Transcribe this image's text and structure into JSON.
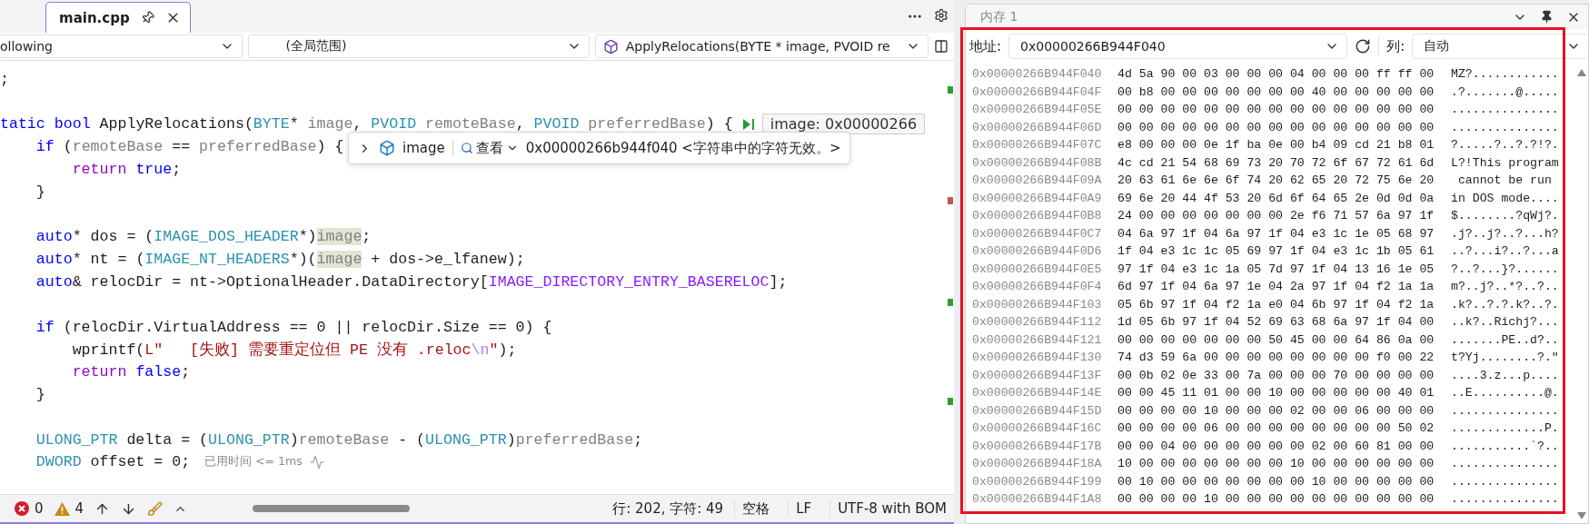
{
  "editor": {
    "tab": {
      "label": "main.cpp",
      "selected": true
    },
    "nav": {
      "project": "ollowing",
      "scope": "(全局范围)",
      "member": "ApplyRelocations(BYTE * image, PVOID re"
    },
    "lines": [
      {
        "kind": "code",
        "tokens": [
          {
            "kind": "plain",
            "text": ";"
          }
        ]
      },
      {
        "kind": "blank"
      },
      {
        "kind": "code",
        "tokens": [
          {
            "kind": "kw",
            "text": "tatic"
          },
          {
            "kind": "kw",
            "text": " bool"
          },
          {
            "kind": "plain",
            "text": " ApplyRelocations("
          },
          {
            "kind": "type",
            "text": "BYTE"
          },
          {
            "kind": "plain",
            "text": "* "
          },
          {
            "kind": "param",
            "text": "image"
          },
          {
            "kind": "plain",
            "text": ", "
          },
          {
            "kind": "type",
            "text": "PVOID"
          },
          {
            "kind": "param",
            "text": " remoteBase"
          },
          {
            "kind": "plain",
            "text": ", "
          },
          {
            "kind": "type",
            "text": "PVOID"
          },
          {
            "kind": "param",
            "text": " preferredBase"
          },
          {
            "kind": "plain",
            "text": ") {"
          }
        ],
        "hint": {
          "kind": "value",
          "text": "image: 0x00000266"
        }
      },
      {
        "kind": "code",
        "tokens": [
          {
            "kind": "kw",
            "text": "    if"
          },
          {
            "kind": "plain",
            "text": " ("
          },
          {
            "kind": "param",
            "text": "remoteBase"
          },
          {
            "kind": "plain",
            "text": " == "
          },
          {
            "kind": "param",
            "text": "preferredBase"
          },
          {
            "kind": "plain",
            "text": ") {"
          }
        ]
      },
      {
        "kind": "code",
        "tokens": [
          {
            "kind": "ctl",
            "text": "        return"
          },
          {
            "kind": "kw",
            "text": " true"
          },
          {
            "kind": "plain",
            "text": ";"
          }
        ]
      },
      {
        "kind": "code",
        "tokens": [
          {
            "kind": "plain",
            "text": "    }"
          }
        ]
      },
      {
        "kind": "blank"
      },
      {
        "kind": "code",
        "tokens": [
          {
            "kind": "kw",
            "text": "    auto"
          },
          {
            "kind": "plain",
            "text": "* dos = ("
          },
          {
            "kind": "type",
            "text": "IMAGE_DOS_HEADER"
          },
          {
            "kind": "plain",
            "text": "*)"
          },
          {
            "kind": "ref",
            "text": "image"
          },
          {
            "kind": "plain",
            "text": ";"
          }
        ]
      },
      {
        "kind": "code",
        "tokens": [
          {
            "kind": "kw",
            "text": "    auto"
          },
          {
            "kind": "plain",
            "text": "* nt = ("
          },
          {
            "kind": "type",
            "text": "IMAGE_NT_HEADERS"
          },
          {
            "kind": "plain",
            "text": "*)("
          },
          {
            "kind": "ref",
            "text": "image"
          },
          {
            "kind": "plain",
            "text": " + dos->e_lfanew);"
          }
        ]
      },
      {
        "kind": "code",
        "tokens": [
          {
            "kind": "kw",
            "text": "    auto"
          },
          {
            "kind": "plain",
            "text": "& relocDir = nt->OptionalHeader.DataDirectory["
          },
          {
            "kind": "macro",
            "text": "IMAGE_DIRECTORY_ENTRY_BASERELOC"
          },
          {
            "kind": "plain",
            "text": "];"
          }
        ]
      },
      {
        "kind": "blank"
      },
      {
        "kind": "code",
        "tokens": [
          {
            "kind": "kw",
            "text": "    if"
          },
          {
            "kind": "plain",
            "text": " (relocDir.VirtualAddress == 0 || relocDir.Size == 0) {"
          }
        ]
      },
      {
        "kind": "code",
        "tokens": [
          {
            "kind": "plain",
            "text": "        wprintf("
          },
          {
            "kind": "str",
            "text": "L\"   [失败] 需要重定位但 PE 没有 .reloc"
          },
          {
            "kind": "esc",
            "text": "\\n"
          },
          {
            "kind": "str",
            "text": "\""
          },
          {
            "kind": "plain",
            "text": ");"
          }
        ]
      },
      {
        "kind": "code",
        "tokens": [
          {
            "kind": "ctl",
            "text": "        return"
          },
          {
            "kind": "kw",
            "text": " false"
          },
          {
            "kind": "plain",
            "text": ";"
          }
        ]
      },
      {
        "kind": "code",
        "tokens": [
          {
            "kind": "plain",
            "text": "    }"
          }
        ]
      },
      {
        "kind": "blank"
      },
      {
        "kind": "code",
        "tokens": [
          {
            "kind": "type",
            "text": "    ULONG_PTR"
          },
          {
            "kind": "plain",
            "text": " delta = ("
          },
          {
            "kind": "type",
            "text": "ULONG_PTR"
          },
          {
            "kind": "plain",
            "text": ")"
          },
          {
            "kind": "param",
            "text": "remoteBase"
          },
          {
            "kind": "plain",
            "text": " - ("
          },
          {
            "kind": "type",
            "text": "ULONG_PTR"
          },
          {
            "kind": "plain",
            "text": ")"
          },
          {
            "kind": "param",
            "text": "preferredBase"
          },
          {
            "kind": "plain",
            "text": ";"
          }
        ]
      },
      {
        "kind": "code",
        "tokens": [
          {
            "kind": "type",
            "text": "    DWORD"
          },
          {
            "kind": "plain",
            "text": " offset = 0;"
          }
        ],
        "hint": {
          "kind": "timing",
          "text": "已用时间 <= 1ms"
        }
      }
    ],
    "datatip": {
      "name": "image",
      "view_label": "查看",
      "value": "0x00000266b944f040 <字符串中的字符无效。>"
    },
    "status": {
      "errors": "0",
      "warnings": "4",
      "position": "行: 202, 字符: 49",
      "indent": "空格",
      "eol": "LF",
      "encoding": "UTF-8 with BOM"
    }
  },
  "memory": {
    "title": "内存 1",
    "address_label": "地址:",
    "address": "0x00000266B944F040",
    "columns_label": "列:",
    "columns": "自动",
    "rows": [
      {
        "address": "0x00000266B944F040",
        "bytes": "4d 5a 90 00 03 00 00 00 04 00 00 00 ff ff 00",
        "ascii": "MZ?............"
      },
      {
        "address": "0x00000266B944F04F",
        "bytes": "00 b8 00 00 00 00 00 00 00 40 00 00 00 00 00",
        "ascii": ".?.......@....."
      },
      {
        "address": "0x00000266B944F05E",
        "bytes": "00 00 00 00 00 00 00 00 00 00 00 00 00 00 00",
        "ascii": "..............."
      },
      {
        "address": "0x00000266B944F06D",
        "bytes": "00 00 00 00 00 00 00 00 00 00 00 00 00 00 00",
        "ascii": "..............."
      },
      {
        "address": "0x00000266B944F07C",
        "bytes": "e8 00 00 00 0e 1f ba 0e 00 b4 09 cd 21 b8 01",
        "ascii": "?.....?..?.?!?."
      },
      {
        "address": "0x00000266B944F08B",
        "bytes": "4c cd 21 54 68 69 73 20 70 72 6f 67 72 61 6d",
        "ascii": "L?!This program"
      },
      {
        "address": "0x00000266B944F09A",
        "bytes": "20 63 61 6e 6e 6f 74 20 62 65 20 72 75 6e 20",
        "ascii": " cannot be run "
      },
      {
        "address": "0x00000266B944F0A9",
        "bytes": "69 6e 20 44 4f 53 20 6d 6f 64 65 2e 0d 0d 0a",
        "ascii": "in DOS mode...."
      },
      {
        "address": "0x00000266B944F0B8",
        "bytes": "24 00 00 00 00 00 00 00 2e f6 71 57 6a 97 1f",
        "ascii": "$........?qWj?."
      },
      {
        "address": "0x00000266B944F0C7",
        "bytes": "04 6a 97 1f 04 6a 97 1f 04 e3 1c 1e 05 68 97",
        "ascii": ".j?..j?..?...h?"
      },
      {
        "address": "0x00000266B944F0D6",
        "bytes": "1f 04 e3 1c 1c 05 69 97 1f 04 e3 1c 1b 05 61",
        "ascii": "..?...i?..?...a"
      },
      {
        "address": "0x00000266B944F0E5",
        "bytes": "97 1f 04 e3 1c 1a 05 7d 97 1f 04 13 16 1e 05",
        "ascii": "?..?...}?......"
      },
      {
        "address": "0x00000266B944F0F4",
        "bytes": "6d 97 1f 04 6a 97 1e 04 2a 97 1f 04 f2 1a 1a",
        "ascii": "m?..j?..*?..?.."
      },
      {
        "address": "0x00000266B944F103",
        "bytes": "05 6b 97 1f 04 f2 1a e0 04 6b 97 1f 04 f2 1a",
        "ascii": ".k?..?.?.k?..?."
      },
      {
        "address": "0x00000266B944F112",
        "bytes": "1d 05 6b 97 1f 04 52 69 63 68 6a 97 1f 04 00",
        "ascii": "..k?..Richj?..."
      },
      {
        "address": "0x00000266B944F121",
        "bytes": "00 00 00 00 00 00 00 50 45 00 00 64 86 0a 00",
        "ascii": ".......PE..d?.."
      },
      {
        "address": "0x00000266B944F130",
        "bytes": "74 d3 59 6a 00 00 00 00 00 00 00 00 f0 00 22",
        "ascii": "t?Yj........?.\""
      },
      {
        "address": "0x00000266B944F13F",
        "bytes": "00 0b 02 0e 33 00 7a 00 00 00 70 00 00 00 00",
        "ascii": "....3.z...p...."
      },
      {
        "address": "0x00000266B944F14E",
        "bytes": "00 00 45 11 01 00 00 10 00 00 00 00 00 40 01",
        "ascii": "..E..........@."
      },
      {
        "address": "0x00000266B944F15D",
        "bytes": "00 00 00 00 10 00 00 00 02 00 00 06 00 00 00",
        "ascii": "..............."
      },
      {
        "address": "0x00000266B944F16C",
        "bytes": "00 00 00 00 06 00 00 00 00 00 00 00 00 50 02",
        "ascii": ".............P."
      },
      {
        "address": "0x00000266B944F17B",
        "bytes": "00 00 04 00 00 00 00 00 00 02 00 60 81 00 00",
        "ascii": "...........`?.."
      },
      {
        "address": "0x00000266B944F18A",
        "bytes": "10 00 00 00 00 00 00 00 10 00 00 00 00 00 00",
        "ascii": "..............."
      },
      {
        "address": "0x00000266B944F199",
        "bytes": "00 10 00 00 00 00 00 00 00 10 00 00 00 00 00",
        "ascii": "..............."
      },
      {
        "address": "0x00000266B944F1A8",
        "bytes": "00 00 00 00 10 00 00 00 00 00 00 00 00 00 00",
        "ascii": "..............."
      }
    ]
  }
}
